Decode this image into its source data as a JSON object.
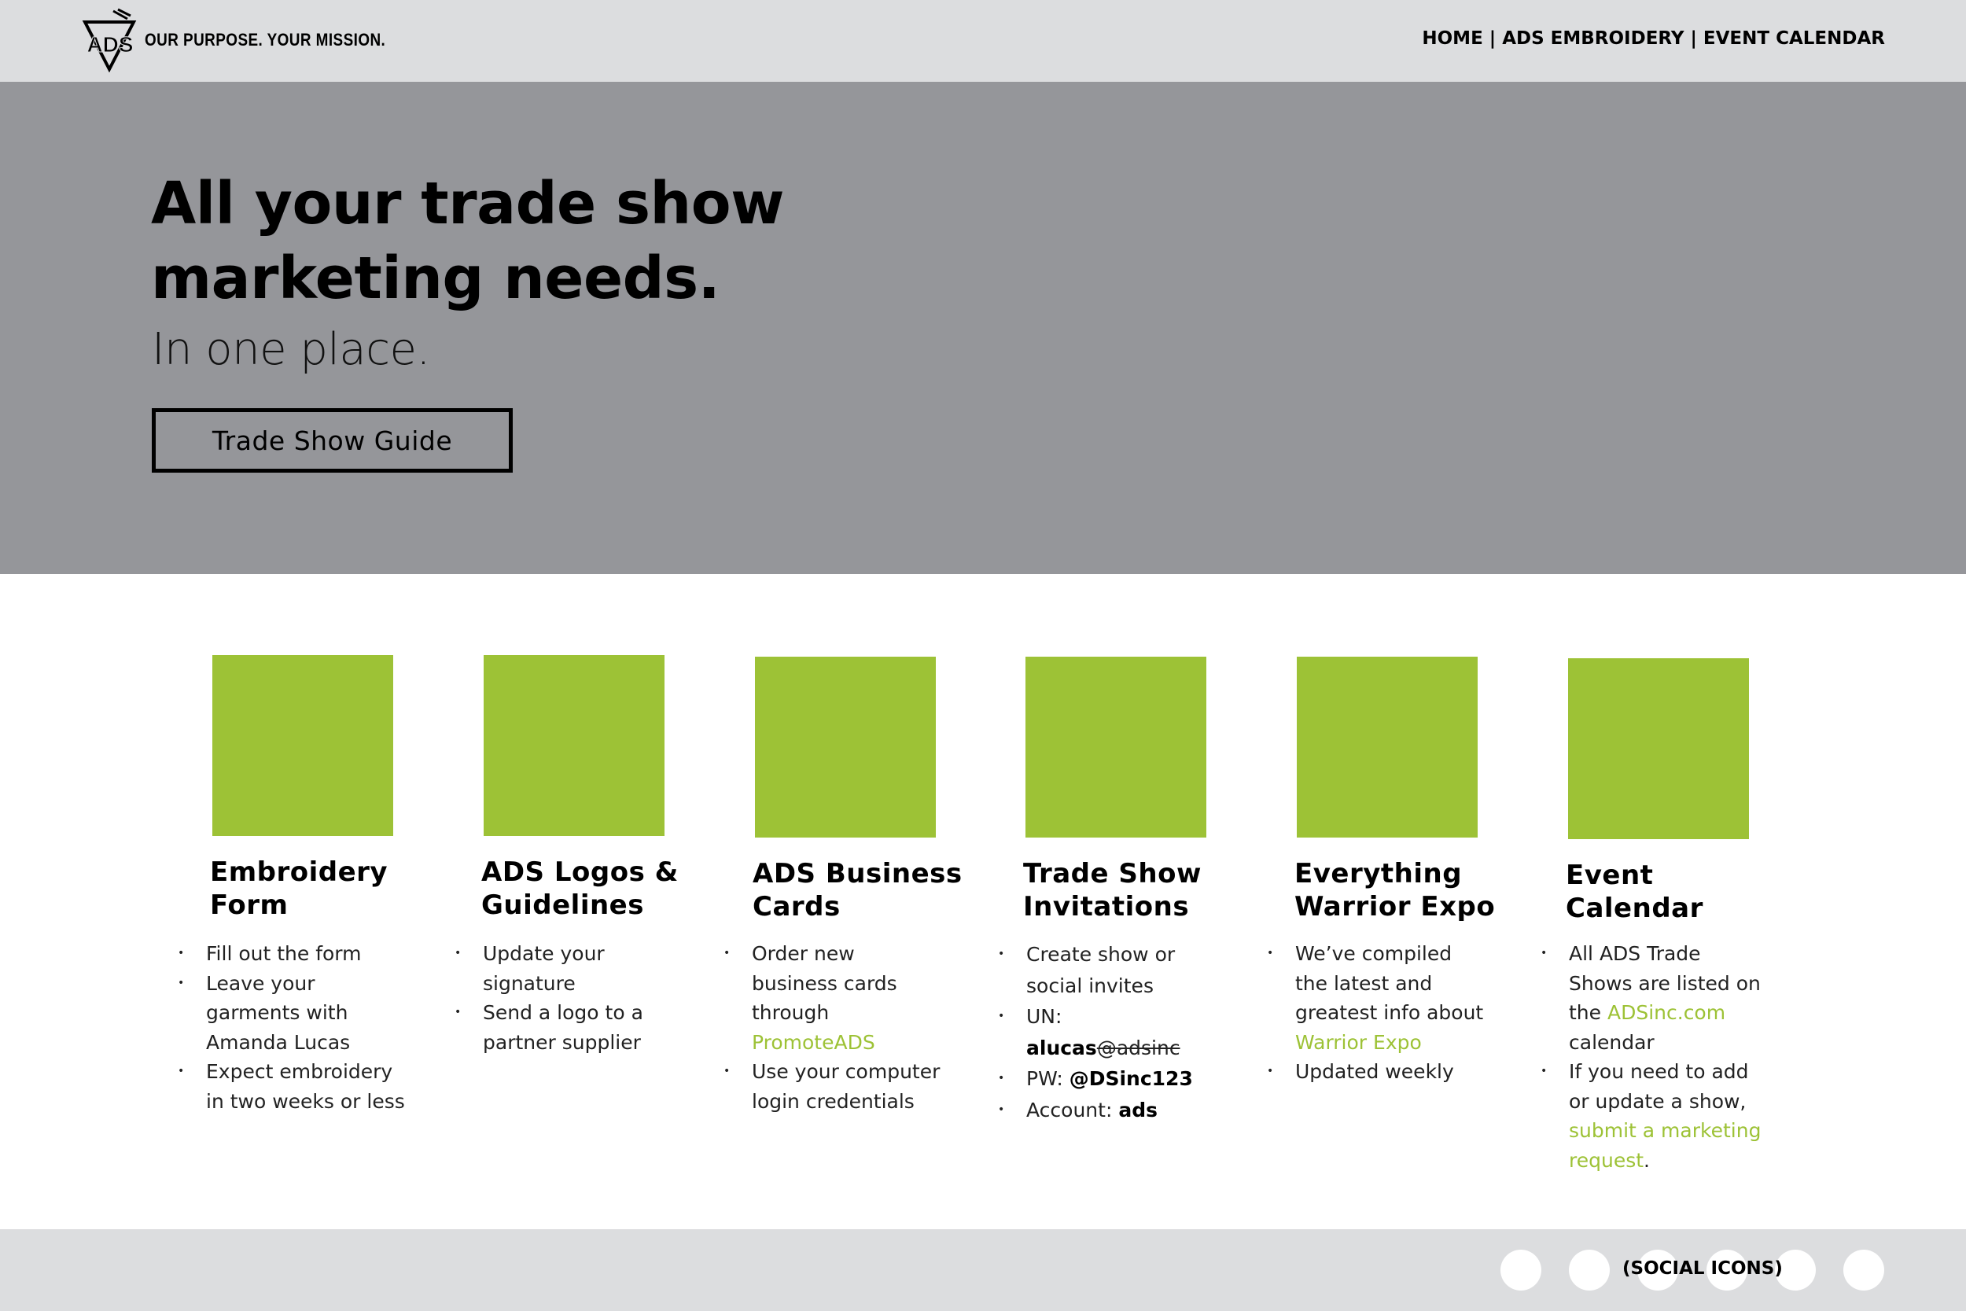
{
  "header": {
    "tagline": "OUR PURPOSE. YOUR MISSION.",
    "logo_text": "ADS",
    "nav": [
      "HOME",
      "ADS EMBROIDERY",
      "EVENT CALENDAR"
    ],
    "nav_separator": "|"
  },
  "hero": {
    "title_line1": "All your trade show",
    "title_line2": "marketing needs.",
    "subtitle": "In one place.",
    "button": "Trade Show Guide"
  },
  "cards": [
    {
      "title_line1": "Embroidery",
      "title_line2": "Form",
      "items": [
        "Fill out the form",
        "Leave your garments with Amanda Lucas",
        "Expect embroidery in two weeks or less"
      ]
    },
    {
      "title_line1": "ADS Logos &",
      "title_line2": "Guidelines",
      "items": [
        "Update your signature",
        "Send a logo to a partner supplier"
      ]
    },
    {
      "title_line1": "ADS Business",
      "title_line2": "Cards",
      "items": {
        "first_text": "Order new business cards through",
        "first_link": "PromoteADS",
        "second": "Use your computer login credentials"
      }
    },
    {
      "title_line1": "Trade Show",
      "title_line2": "Invitations",
      "items": {
        "first": "Create show or social invites",
        "un_label": "UN:",
        "un_value": "alucas",
        "un_domain": "@adsinc",
        "pw_label": "PW:",
        "pw_value": "@DSinc123",
        "account_label": "Account:",
        "account_value": "ads"
      }
    },
    {
      "title_line1": "Everything",
      "title_line2": "Warrior Expo",
      "items": {
        "first_text": "We’ve compiled the latest and greatest info about",
        "first_link": "Warrior Expo",
        "second": "Updated weekly"
      }
    },
    {
      "title_line1": "Event",
      "title_line2": "Calendar",
      "items": {
        "first_text": "All ADS Trade Shows are listed on the",
        "first_link": "ADSinc.com",
        "first_after": "calendar",
        "second_text": "If you need to add or update a show,",
        "second_link": "submit a marketing request",
        "second_after": "."
      }
    }
  ],
  "footer": {
    "social_label": "(SOCIAL ICONS)",
    "social_icons": [
      "social-icon-1",
      "social-icon-2",
      "social-icon-3",
      "social-icon-4",
      "social-icon-5",
      "social-icon-6"
    ]
  },
  "colors": {
    "accent": "#9dc236",
    "topbar": "#dcdddf",
    "hero": "#95969a"
  }
}
